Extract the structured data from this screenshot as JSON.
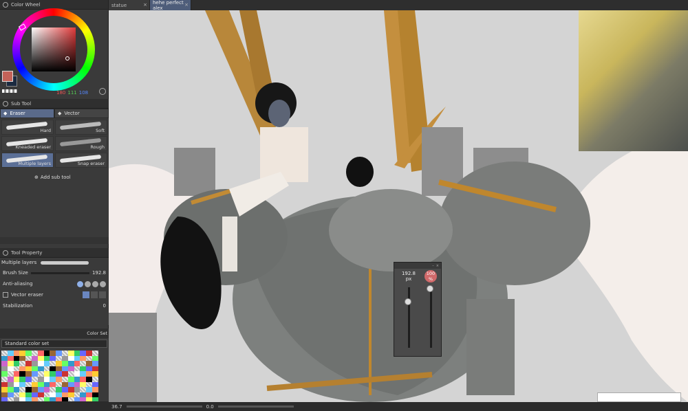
{
  "color_wheel": {
    "title": "Color Wheel",
    "r": "180",
    "g": "111",
    "b": "108"
  },
  "sub_tool": {
    "title": "Sub Tool",
    "tabs": [
      "Eraser",
      "Vector"
    ],
    "brushes": [
      "Hard",
      "Soft",
      "Kneaded eraser",
      "Rough",
      "Multiple layers",
      "Snap eraser"
    ],
    "add_label": "Add sub tool"
  },
  "tool_property": {
    "title": "Tool Property",
    "preset": "Multiple layers",
    "brush_size_label": "Brush Size",
    "brush_size_value": "192.8",
    "anti_aliasing_label": "Anti-aliasing",
    "vector_eraser_label": "Vector eraser",
    "stabilization_label": "Stabilization",
    "stabilization_value": "0"
  },
  "color_set": {
    "title": "Color Set",
    "selected": "Standard color set"
  },
  "tabs": [
    "statue",
    "hehe perfect alex"
  ],
  "popup": {
    "size_value": "192.8",
    "size_unit": "px",
    "opacity_value": "100",
    "opacity_unit": "%"
  },
  "status": {
    "zoom": "36.7",
    "angle": "0.0"
  }
}
